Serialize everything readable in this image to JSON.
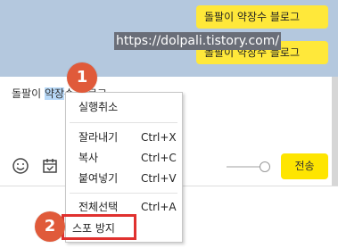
{
  "chat": {
    "bubbles": [
      "돌팔이 약장수 블로그",
      "돌팔이 약장수 블로그"
    ],
    "selected_url": "https://dolpali.tistory.com/"
  },
  "input": {
    "text_prefix": "돌팔이 ",
    "text_selected": "약장",
    "text_suffix": "수 블로그"
  },
  "toolbar": {
    "send_label": "전송",
    "emoji_icon": "emoji-icon",
    "calendar_icon": "calendar-icon"
  },
  "context_menu": {
    "undo": "실행취소",
    "cut": "잘라내기",
    "cut_shortcut": "Ctrl+X",
    "copy": "복사",
    "copy_shortcut": "Ctrl+C",
    "paste": "붙여넣기",
    "paste_shortcut": "Ctrl+V",
    "select_all": "전체선택",
    "select_all_shortcut": "Ctrl+A",
    "spam_prevent": "스포 방지"
  },
  "annotations": {
    "step1": "1",
    "step2": "2"
  },
  "colors": {
    "chat_bg": "#b4c8de",
    "bubble": "#ffe83a",
    "send_button": "#fee500",
    "badge": "#e05a3a",
    "highlight_box": "#e0312f"
  }
}
